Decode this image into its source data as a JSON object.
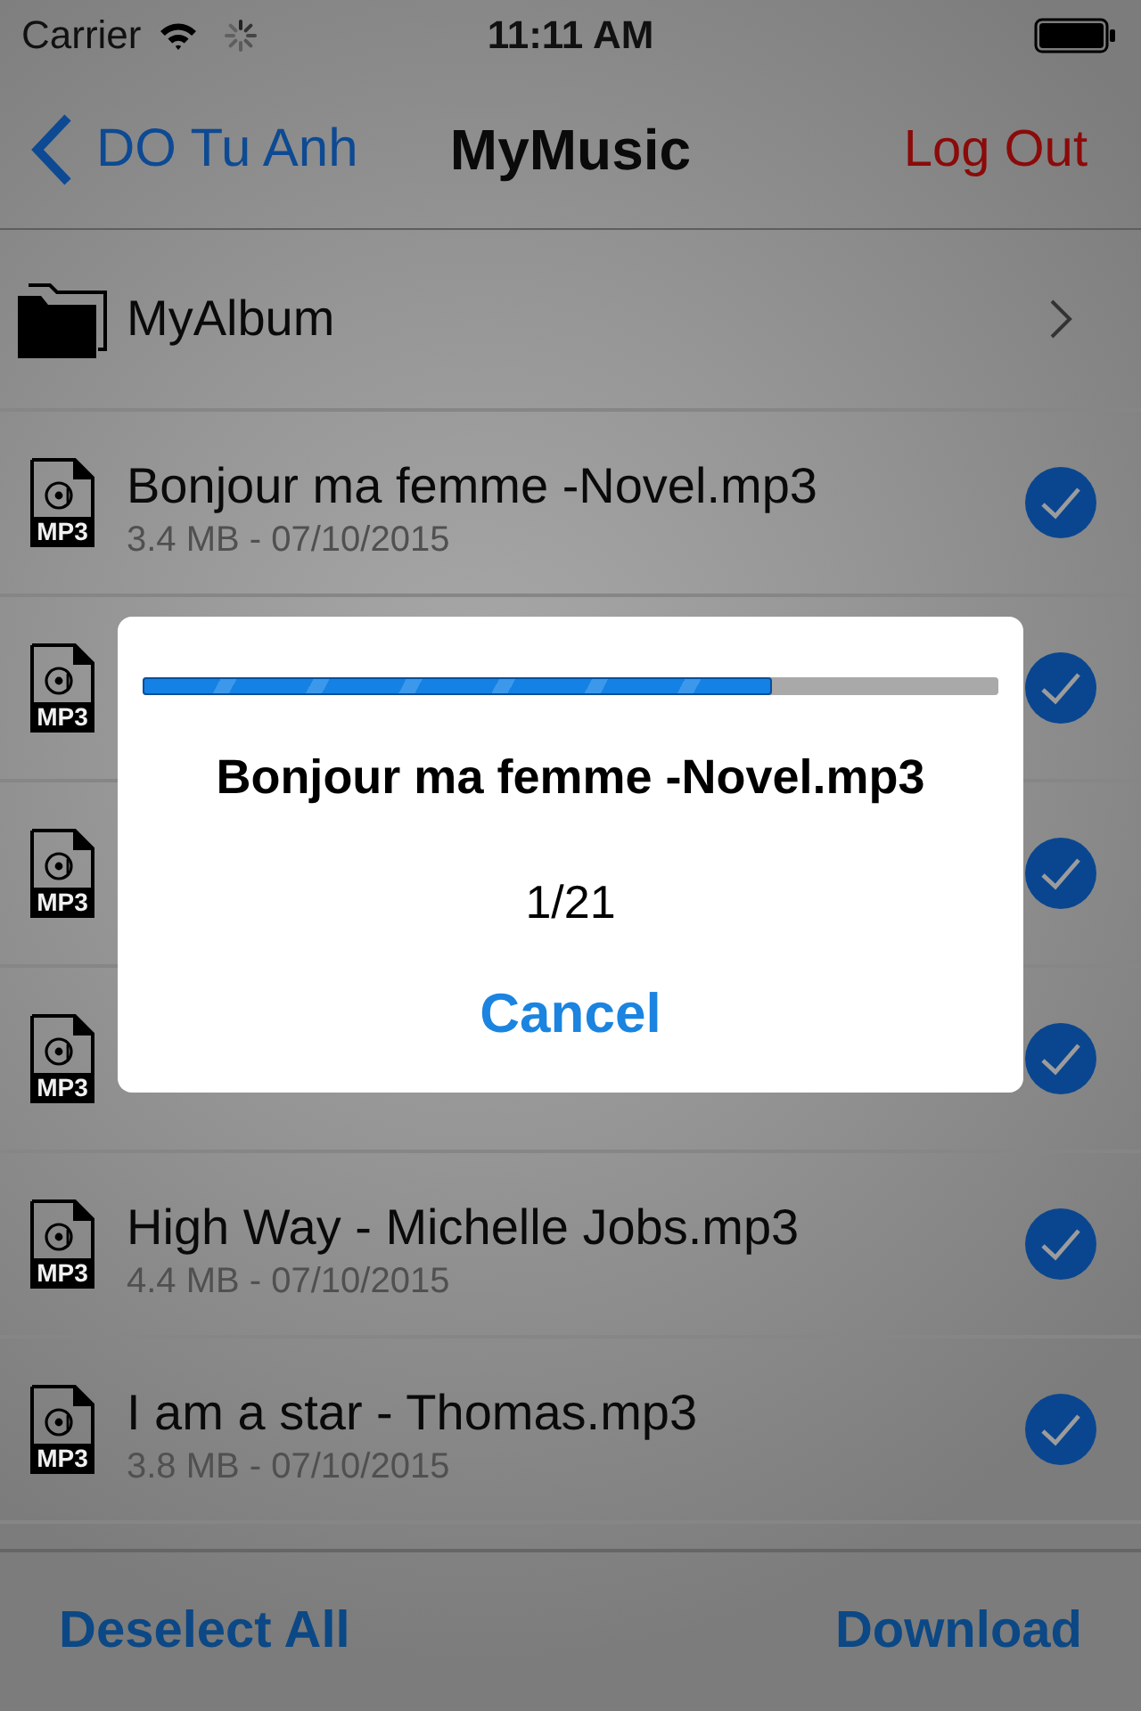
{
  "status_bar": {
    "carrier": "Carrier",
    "time": "11:11 AM"
  },
  "nav_bar": {
    "back": "DO Tu Anh",
    "title": "MyMusic",
    "action": "Log Out"
  },
  "list": [
    {
      "kind": "folder",
      "title": "MyAlbum"
    },
    {
      "kind": "file",
      "type_label": "MP3",
      "title": "Bonjour ma femme -Novel.mp3",
      "subtitle": "3.4 MB - 07/10/2015",
      "checked": true
    },
    {
      "kind": "file",
      "type_label": "MP3",
      "checked": true
    },
    {
      "kind": "file",
      "type_label": "MP3",
      "checked": true
    },
    {
      "kind": "file",
      "type_label": "MP3",
      "checked": true
    },
    {
      "kind": "file",
      "type_label": "MP3",
      "title": "High Way - Michelle Jobs.mp3",
      "subtitle": "4.4 MB - 07/10/2015",
      "checked": true
    },
    {
      "kind": "file",
      "type_label": "MP3",
      "title": "I am a star - Thomas.mp3",
      "subtitle": "3.8 MB - 07/10/2015",
      "checked": true
    }
  ],
  "progress_dialog": {
    "level": 0.735,
    "file_name": "Bonjour ma femme -Novel.mp3",
    "count": "1/21",
    "cancel": "Cancel"
  },
  "toolbar": {
    "buttons": [
      "Deselect All",
      "Download"
    ]
  }
}
